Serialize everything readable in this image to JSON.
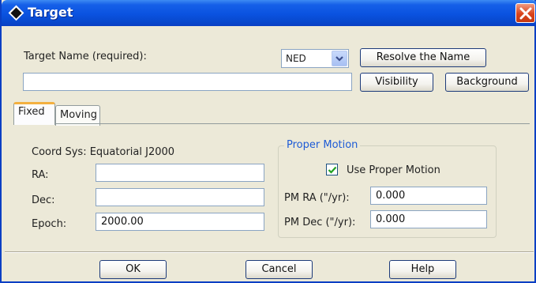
{
  "window": {
    "title": "Target",
    "icon": "diamond-app-icon"
  },
  "target_name": {
    "label": "Target Name (required):",
    "value": ""
  },
  "name_service": {
    "selected": "NED"
  },
  "buttons": {
    "resolve": "Resolve the Name",
    "visibility": "Visibility",
    "background": "Background",
    "ok": "OK",
    "cancel": "Cancel",
    "help": "Help"
  },
  "tabs": [
    {
      "label": "Fixed",
      "active": true
    },
    {
      "label": "Moving",
      "active": false
    }
  ],
  "fixed": {
    "coord_sys": "Coord Sys: Equatorial J2000",
    "ra_label": "RA:",
    "ra_value": "",
    "dec_label": "Dec:",
    "dec_value": "",
    "epoch_label": "Epoch:",
    "epoch_value": "2000.00"
  },
  "proper_motion": {
    "title": "Proper Motion",
    "use_label": "Use Proper Motion",
    "use_checked": true,
    "pm_ra_label": "PM RA (\"/yr):",
    "pm_ra_value": "0.000",
    "pm_dec_label": "PM Dec (\"/yr):",
    "pm_dec_value": "0.000"
  },
  "colors": {
    "titlebar": "#0a52e0",
    "accent_tab": "#f3b040",
    "group_title": "#1d5bd6",
    "close": "#d9431b"
  }
}
